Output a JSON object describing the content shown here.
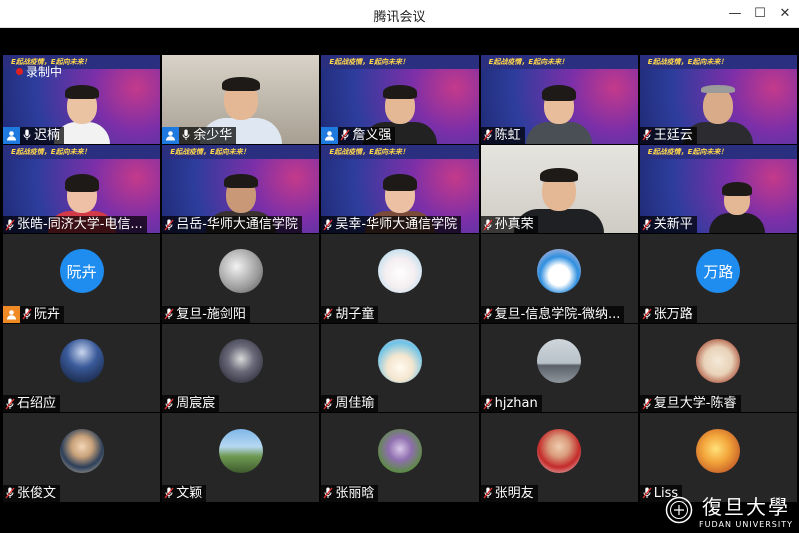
{
  "window": {
    "title": "腾讯会议",
    "minimize_glyph": "—",
    "maximize_glyph": "☐",
    "close_glyph": "✕"
  },
  "recording": {
    "label": "录制中"
  },
  "banner_text": "E起战疫情，E起向未来！",
  "participants": [
    {
      "name": "迟楠",
      "type": "video",
      "host": true
    },
    {
      "name": "余少华",
      "type": "video",
      "host": true
    },
    {
      "name": "詹义强",
      "type": "video",
      "host": true
    },
    {
      "name": "陈虹",
      "type": "video"
    },
    {
      "name": "王廷云",
      "type": "video"
    },
    {
      "name": "张皓-同济大学-电信...",
      "type": "video"
    },
    {
      "name": "吕岳-华师大通信学院",
      "type": "video"
    },
    {
      "name": "吴幸-华师大通信学院",
      "type": "video"
    },
    {
      "name": "孙真荣",
      "type": "video"
    },
    {
      "name": "关新平",
      "type": "video"
    },
    {
      "name": "阮卉",
      "type": "avatar-text",
      "avatar_text": "阮卉",
      "host": true
    },
    {
      "name": "复旦-施剑阳",
      "type": "avatar"
    },
    {
      "name": "胡子童",
      "type": "avatar"
    },
    {
      "name": "复旦-信息学院-微纳...",
      "type": "avatar"
    },
    {
      "name": "张万路",
      "type": "avatar-text",
      "avatar_text": "万路"
    },
    {
      "name": "石绍应",
      "type": "avatar"
    },
    {
      "name": "周宸宸",
      "type": "avatar"
    },
    {
      "name": "周佳瑜",
      "type": "avatar"
    },
    {
      "name": "hjzhan",
      "type": "avatar"
    },
    {
      "name": "复旦大学-陈睿",
      "type": "avatar"
    },
    {
      "name": "张俊文",
      "type": "avatar"
    },
    {
      "name": "文颖",
      "type": "avatar"
    },
    {
      "name": "张丽晗",
      "type": "avatar"
    },
    {
      "name": "张明友",
      "type": "avatar"
    },
    {
      "name": "Liss",
      "type": "avatar"
    }
  ],
  "logo": {
    "cn": "復旦大學",
    "en": "FUDAN UNIVERSITY"
  },
  "colors": {
    "accent": "#1f7ae0",
    "host_orange": "#f08a24",
    "tile_bg": "#262626"
  }
}
